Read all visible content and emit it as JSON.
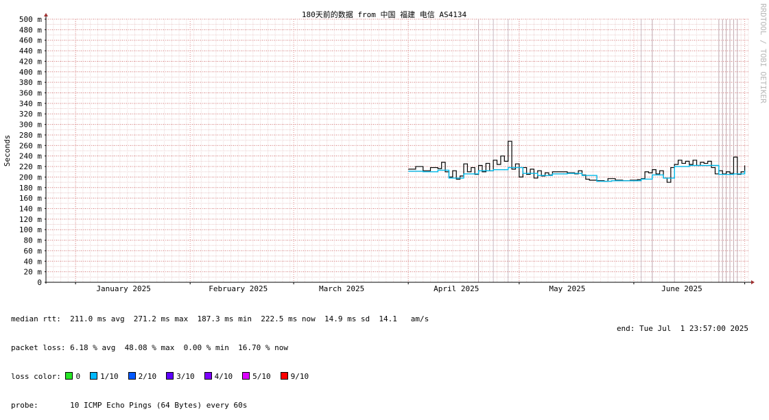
{
  "chart_data": {
    "type": "line",
    "title": "180天前的数据 from 中国 福建 电信 AS4134",
    "ylabel": "Seconds",
    "watermark": "RRDTOOL / TOBI OETIKER",
    "ylim": [
      0,
      500
    ],
    "yticks": [
      {
        "v": 0,
        "label": "0"
      },
      {
        "v": 20,
        "label": "20 m"
      },
      {
        "v": 40,
        "label": "40 m"
      },
      {
        "v": 60,
        "label": "60 m"
      },
      {
        "v": 80,
        "label": "80 m"
      },
      {
        "v": 100,
        "label": "100 m"
      },
      {
        "v": 120,
        "label": "120 m"
      },
      {
        "v": 140,
        "label": "140 m"
      },
      {
        "v": 160,
        "label": "160 m"
      },
      {
        "v": 180,
        "label": "180 m"
      },
      {
        "v": 200,
        "label": "200 m"
      },
      {
        "v": 220,
        "label": "220 m"
      },
      {
        "v": 240,
        "label": "240 m"
      },
      {
        "v": 260,
        "label": "260 m"
      },
      {
        "v": 280,
        "label": "280 m"
      },
      {
        "v": 300,
        "label": "300 m"
      },
      {
        "v": 320,
        "label": "320 m"
      },
      {
        "v": 340,
        "label": "340 m"
      },
      {
        "v": 360,
        "label": "360 m"
      },
      {
        "v": 380,
        "label": "380 m"
      },
      {
        "v": 400,
        "label": "400 m"
      },
      {
        "v": 420,
        "label": "420 m"
      },
      {
        "v": 440,
        "label": "440 m"
      },
      {
        "v": 460,
        "label": "460 m"
      },
      {
        "v": 480,
        "label": "480 m"
      },
      {
        "v": 500,
        "label": "500 m"
      }
    ],
    "xlim": [
      "2024-12-24",
      "2025-07-02"
    ],
    "xticks": [
      {
        "date": "2025-01-14",
        "label": "January 2025"
      },
      {
        "date": "2025-02-14",
        "label": "February 2025"
      },
      {
        "date": "2025-03-14",
        "label": "March 2025"
      },
      {
        "date": "2025-04-14",
        "label": "April 2025"
      },
      {
        "date": "2025-05-14",
        "label": "May 2025"
      },
      {
        "date": "2025-06-14",
        "label": "June 2025"
      }
    ],
    "month_starts": [
      "2025-01-01",
      "2025-02-01",
      "2025-03-01",
      "2025-04-01",
      "2025-05-01",
      "2025-06-01",
      "2025-07-01"
    ],
    "grid": true,
    "series": [
      {
        "color": "#000000",
        "points": [
          [
            "2025-04-01",
            215
          ],
          [
            "2025-04-03",
            220
          ],
          [
            "2025-04-05",
            212
          ],
          [
            "2025-04-07",
            218
          ],
          [
            "2025-04-09",
            216
          ],
          [
            "2025-04-10",
            228
          ],
          [
            "2025-04-11",
            210
          ],
          [
            "2025-04-12",
            200
          ],
          [
            "2025-04-13",
            212
          ],
          [
            "2025-04-14",
            196
          ],
          [
            "2025-04-15",
            202
          ],
          [
            "2025-04-16",
            225
          ],
          [
            "2025-04-17",
            210
          ],
          [
            "2025-04-18",
            218
          ],
          [
            "2025-04-19",
            205
          ],
          [
            "2025-04-20",
            222
          ],
          [
            "2025-04-21",
            210
          ],
          [
            "2025-04-22",
            226
          ],
          [
            "2025-04-23",
            212
          ],
          [
            "2025-04-24",
            232
          ],
          [
            "2025-04-25",
            224
          ],
          [
            "2025-04-26",
            240
          ],
          [
            "2025-04-27",
            230
          ],
          [
            "2025-04-28",
            268
          ],
          [
            "2025-04-29",
            215
          ],
          [
            "2025-04-30",
            225
          ],
          [
            "2025-05-01",
            200
          ],
          [
            "2025-05-02",
            218
          ],
          [
            "2025-05-03",
            205
          ],
          [
            "2025-05-04",
            215
          ],
          [
            "2025-05-05",
            198
          ],
          [
            "2025-05-06",
            212
          ],
          [
            "2025-05-07",
            202
          ],
          [
            "2025-05-08",
            208
          ],
          [
            "2025-05-09",
            204
          ],
          [
            "2025-05-10",
            210
          ],
          [
            "2025-05-12",
            210
          ],
          [
            "2025-05-14",
            208
          ],
          [
            "2025-05-16",
            206
          ],
          [
            "2025-05-17",
            212
          ],
          [
            "2025-05-18",
            204
          ],
          [
            "2025-05-19",
            196
          ],
          [
            "2025-05-20",
            194
          ],
          [
            "2025-05-22",
            193
          ],
          [
            "2025-05-24",
            192
          ],
          [
            "2025-05-25",
            197
          ],
          [
            "2025-05-27",
            194
          ],
          [
            "2025-05-29",
            193
          ],
          [
            "2025-05-31",
            194
          ],
          [
            "2025-06-02",
            195
          ],
          [
            "2025-06-03",
            197
          ],
          [
            "2025-06-04",
            210
          ],
          [
            "2025-06-05",
            208
          ],
          [
            "2025-06-06",
            214
          ],
          [
            "2025-06-07",
            206
          ],
          [
            "2025-06-08",
            212
          ],
          [
            "2025-06-09",
            198
          ],
          [
            "2025-06-10",
            190
          ],
          [
            "2025-06-11",
            218
          ],
          [
            "2025-06-12",
            224
          ],
          [
            "2025-06-13",
            232
          ],
          [
            "2025-06-14",
            226
          ],
          [
            "2025-06-15",
            230
          ],
          [
            "2025-06-16",
            224
          ],
          [
            "2025-06-17",
            232
          ],
          [
            "2025-06-18",
            222
          ],
          [
            "2025-06-19",
            228
          ],
          [
            "2025-06-20",
            226
          ],
          [
            "2025-06-21",
            230
          ],
          [
            "2025-06-22",
            218
          ],
          [
            "2025-06-23",
            206
          ],
          [
            "2025-06-24",
            212
          ],
          [
            "2025-06-25",
            206
          ],
          [
            "2025-06-26",
            210
          ],
          [
            "2025-06-27",
            207
          ],
          [
            "2025-06-28",
            238
          ],
          [
            "2025-06-29",
            205
          ],
          [
            "2025-06-30",
            210
          ],
          [
            "2025-07-01",
            222
          ]
        ]
      },
      {
        "color": "#00b8e8",
        "points": [
          [
            "2025-04-01",
            211
          ],
          [
            "2025-04-05",
            210
          ],
          [
            "2025-04-09",
            213
          ],
          [
            "2025-04-12",
            198
          ],
          [
            "2025-04-16",
            206
          ],
          [
            "2025-04-20",
            212
          ],
          [
            "2025-04-24",
            214
          ],
          [
            "2025-04-28",
            218
          ],
          [
            "2025-05-02",
            207
          ],
          [
            "2025-05-06",
            203
          ],
          [
            "2025-05-10",
            206
          ],
          [
            "2025-05-14",
            207
          ],
          [
            "2025-05-18",
            203
          ],
          [
            "2025-05-22",
            192
          ],
          [
            "2025-05-26",
            193
          ],
          [
            "2025-05-30",
            193
          ],
          [
            "2025-06-03",
            196
          ],
          [
            "2025-06-06",
            204
          ],
          [
            "2025-06-09",
            198
          ],
          [
            "2025-06-12",
            220
          ],
          [
            "2025-06-16",
            222
          ],
          [
            "2025-06-20",
            222
          ],
          [
            "2025-06-24",
            205
          ],
          [
            "2025-06-28",
            206
          ],
          [
            "2025-07-01",
            212
          ]
        ]
      }
    ],
    "loss_lines": [
      {
        "date": "2025-04-20",
        "color": "#c0a8b0"
      },
      {
        "date": "2025-04-24",
        "color": "#c8b8c0"
      },
      {
        "date": "2025-04-28",
        "color": "#c8b8c0"
      },
      {
        "date": "2025-06-03",
        "color": "#c8b8c0"
      },
      {
        "date": "2025-06-06",
        "color": "#c0a8b0"
      },
      {
        "date": "2025-06-12",
        "color": "#c8b8c0"
      },
      {
        "date": "2025-06-24",
        "color": "#c0a8b0"
      },
      {
        "date": "2025-06-25",
        "color": "#c0a8b0"
      },
      {
        "date": "2025-06-26",
        "color": "#c0a8b0"
      },
      {
        "date": "2025-06-27",
        "color": "#c0a8b0"
      },
      {
        "date": "2025-06-28",
        "color": "#c0a8b0"
      },
      {
        "date": "2025-06-29",
        "color": "#c0a8b0"
      }
    ]
  },
  "legend": {
    "median_rtt": "median rtt:  211.0 ms avg  271.2 ms max  187.3 ms min  222.5 ms now  14.9 ms sd  14.1   am/s",
    "packet_loss": "packet loss: 6.18 % avg  48.08 % max  0.00 % min  16.70 % now",
    "loss_color_label": "loss color:",
    "loss_colors": [
      {
        "label": "0",
        "color": "#26e626"
      },
      {
        "label": "1/10",
        "color": "#00b8ff"
      },
      {
        "label": "2/10",
        "color": "#0059ff"
      },
      {
        "label": "3/10",
        "color": "#5e00ff"
      },
      {
        "label": "4/10",
        "color": "#7e00ff"
      },
      {
        "label": "5/10",
        "color": "#dd00ff"
      },
      {
        "label": "9/10",
        "color": "#ff0000"
      }
    ],
    "probe": "probe:       10 ICMP Echo Pings (64 Bytes) every 60s",
    "end": "end: Tue Jul  1 23:57:00 2025"
  }
}
